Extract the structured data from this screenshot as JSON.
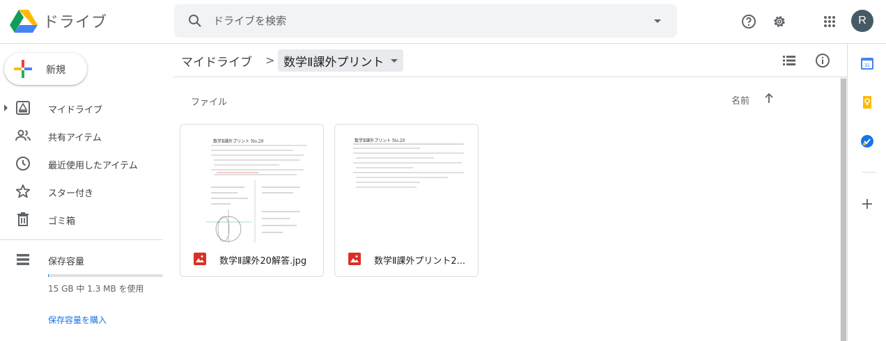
{
  "header": {
    "app_name": "ドライブ",
    "search_placeholder": "ドライブを検索",
    "avatar_initial": "R"
  },
  "sidebar": {
    "new_label": "新規",
    "items": [
      {
        "label": "マイドライブ",
        "icon": "my-drive-icon"
      },
      {
        "label": "共有アイテム",
        "icon": "shared-icon"
      },
      {
        "label": "最近使用したアイテム",
        "icon": "recent-clock-icon"
      },
      {
        "label": "スター付き",
        "icon": "star-icon"
      },
      {
        "label": "ゴミ箱",
        "icon": "trash-icon"
      }
    ],
    "storage": {
      "label": "保存容量",
      "usage_text": "15 GB 中 1.3 MB を使用",
      "used_fraction": 0.0001,
      "buy_link": "保存容量を購入"
    }
  },
  "main": {
    "breadcrumb_root": "マイドライブ",
    "breadcrumb_separator": ">",
    "breadcrumb_current": "数学Ⅱ課外プリント",
    "section_label": "ファイル",
    "sort_label": "名前",
    "files": [
      {
        "name": "数学Ⅱ課外20解答.jpg",
        "type": "image",
        "thumb_title": "数学Ⅱ課外プリント No.20"
      },
      {
        "name": "数学Ⅱ課外プリント2...",
        "type": "image",
        "thumb_title": "数学Ⅱ課外プリント No.20"
      }
    ]
  },
  "colors": {
    "accent": "#1a73e8",
    "image_file_icon": "#d93025",
    "avatar_bg": "#455a64"
  }
}
